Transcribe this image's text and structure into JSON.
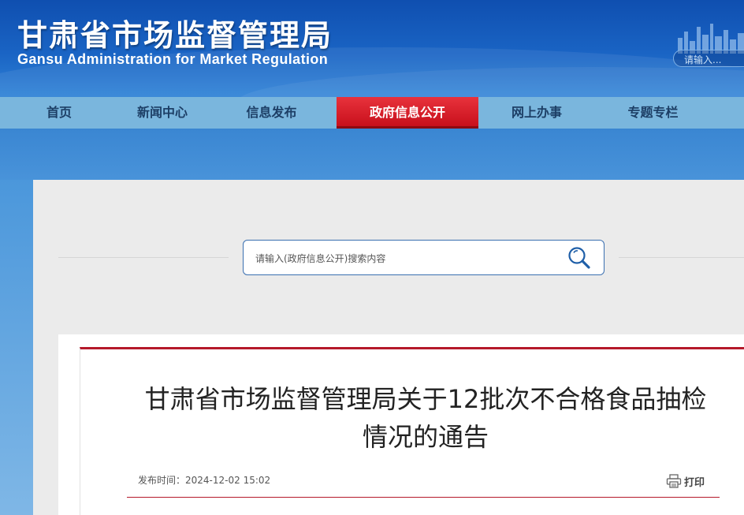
{
  "header": {
    "title": "甘肃省市场监督管理局",
    "subtitle": "Gansu Administration for Market Regulation",
    "search_placeholder": "请输入..."
  },
  "nav": {
    "items": [
      {
        "label": "首页"
      },
      {
        "label": "新闻中心"
      },
      {
        "label": "信息发布"
      },
      {
        "label": "政府信息公开",
        "active": true
      },
      {
        "label": "网上办事"
      },
      {
        "label": "专题专栏"
      }
    ]
  },
  "search": {
    "placeholder": "请输入(政府信息公开)搜索内容",
    "icon": "search-icon"
  },
  "article": {
    "title": "甘肃省市场监督管理局关于12批次不合格食品抽检情况的通告",
    "publish_label": "发布时间：",
    "publish_time": "2024-12-02 15:02",
    "print_label": "打印",
    "print_icon": "printer-icon"
  },
  "colors": {
    "header_blue": "#1a64c4",
    "nav_bg": "#7ab6dd",
    "nav_active": "#d41e28",
    "accent_red": "#b5192a"
  }
}
